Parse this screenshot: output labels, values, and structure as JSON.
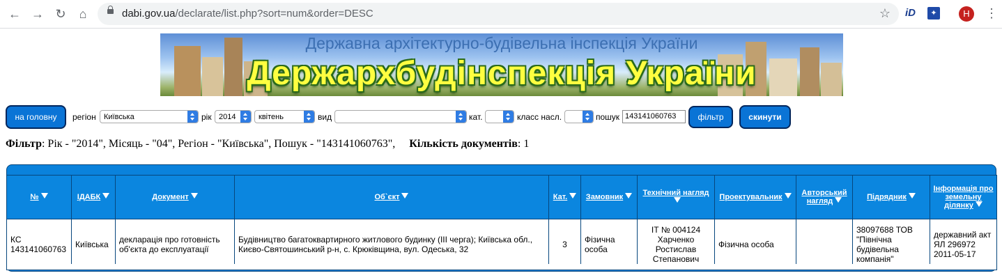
{
  "browser": {
    "url_host": "dabi.gov.ua",
    "url_path": "/declarate/list.php?sort=num&order=DESC",
    "extension_1": "iD",
    "avatar_initial": "H"
  },
  "banner": {
    "subtitle": "Державна архітектурно-будівельна інспекція України",
    "title": "Держархбудінспекція України"
  },
  "filter_bar": {
    "home_label": "на головну",
    "region_label": "регіон",
    "region_value": "Київська",
    "year_label": "рік",
    "year_value": "2014",
    "month_value": "квітень",
    "type_label": "вид",
    "type_value": "",
    "cat_label": "кат.",
    "cat_value": "",
    "class_label": "класс насл.",
    "class_value": "",
    "search_label": "пошук",
    "search_value": "143141060763",
    "filter_button": "фільтр",
    "reset_button": "скинути"
  },
  "summary": {
    "filter_label": "Фільтр",
    "filter_text": ": Рік - \"2014\", Місяць - \"04\", Регіон - \"Київська\", Пошук - \"143141060763\",",
    "count_label": "Кількість документів",
    "count_text": ": 1"
  },
  "table": {
    "headers": {
      "num": "№",
      "idabk": "ІДАБК",
      "document": "Документ",
      "object": "Об`єкт",
      "cat": "Кат.",
      "customer": "Замовник",
      "tech_supervision": "Технічний нагляд",
      "designer": "Проектувальник",
      "author_supervision": "Авторський нагляд",
      "contractor": "Підрядник",
      "land_info": "Інформація про земельну ділянку"
    },
    "rows": [
      {
        "num": "КС 143141060763",
        "idabk": "Київська",
        "document": "декларація про готовність об'єкта до експлуатації",
        "object": "Будівництво багатоквартирного житлового будинку (III черга); Київська обл., Києво-Святошинський р-н, с. Крюківщина, вул. Одеська, 32",
        "cat": "3",
        "customer": "Фізична особа",
        "tech_supervision": "ІТ № 004124 Харченко Ростислав Степанович",
        "designer": "Фізична особа",
        "author_supervision": "",
        "contractor": "38097688 ТОВ \"Північна будівельна компанія\"",
        "land_info": "державний акт ЯЛ 296972 2011-05-17"
      }
    ]
  },
  "colors": {
    "table_blue": "#0b86df",
    "button_blue": "#0a74d6",
    "banner_title_yellow": "#ffff40"
  }
}
